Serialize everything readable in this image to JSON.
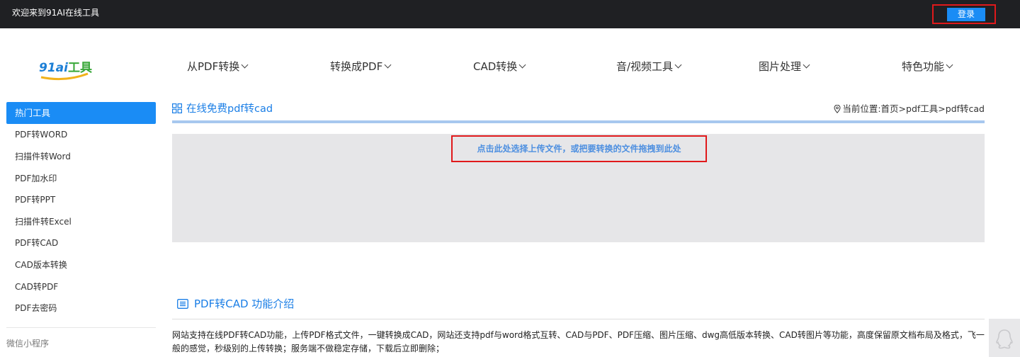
{
  "topbar": {
    "welcome": "欢迎来到91AI在线工具",
    "login_label": "登录"
  },
  "nav": {
    "items": [
      {
        "label": "从PDF转换"
      },
      {
        "label": "转换成PDF"
      },
      {
        "label": "CAD转换"
      },
      {
        "label": "音/视频工具"
      },
      {
        "label": "图片处理"
      },
      {
        "label": "特色功能"
      }
    ]
  },
  "sidebar": {
    "active": "热门工具",
    "items": [
      "PDF转WORD",
      "扫描件转Word",
      "PDF加水印",
      "PDF转PPT",
      "扫描件转Excel",
      "PDF转CAD",
      "CAD版本转换",
      "CAD转PDF",
      "PDF去密码"
    ],
    "mini_program": "微信小程序"
  },
  "page": {
    "title": "在线免费pdf转cad",
    "breadcrumb": "当前位置:首页>pdf工具>pdf转cad"
  },
  "upload": {
    "hint": "点击此处选择上传文件，或把要转换的文件拖拽到此处"
  },
  "intro": {
    "title": "PDF转CAD 功能介绍",
    "text": "网站支持在线PDF转CAD功能，上传PDF格式文件，一键转换成CAD，网站还支持pdf与word格式互转、CAD与PDF、PDF压缩、图片压缩、dwg高低版本转换、CAD转图片等功能，高度保留原文档布局及格式，飞一般的感觉，秒级别的上传转换；服务端不做稳定存储，下载后立即删除；"
  },
  "colors": {
    "accent": "#1a8cf5",
    "topbar": "#1f2023",
    "highlight_border": "#e0191b"
  }
}
